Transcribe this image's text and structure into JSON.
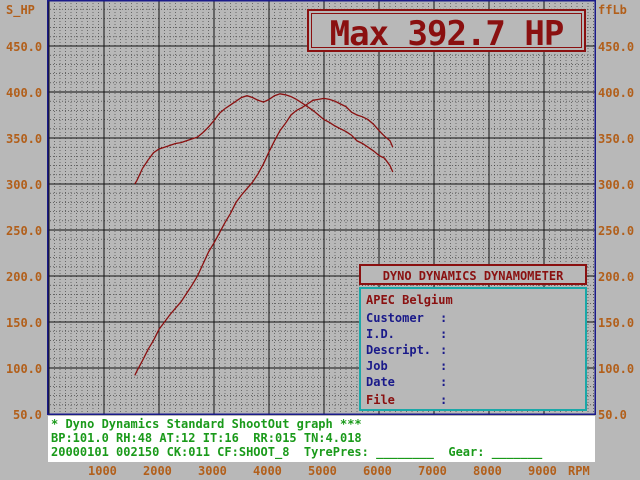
{
  "left_axis": {
    "unit": "S_HP",
    "ticks": [
      "450.0",
      "400.0",
      "350.0",
      "300.0",
      "250.0",
      "200.0",
      "150.0",
      "100.0",
      "50.0"
    ]
  },
  "right_axis": {
    "unit": "ffLb",
    "ticks": [
      "450.0",
      "400.0",
      "350.0",
      "300.0",
      "250.0",
      "200.0",
      "150.0",
      "100.0",
      "50.0"
    ]
  },
  "x_axis": {
    "unit": "RPM",
    "ticks": [
      "1000",
      "2000",
      "3000",
      "4000",
      "5000",
      "6000",
      "7000",
      "8000",
      "9000"
    ]
  },
  "max_readout": "Max 392.7 HP",
  "info_panel": {
    "title": "DYNO DYNAMICS DYNAMOMETER",
    "company": "APEC Belgium",
    "labels": [
      "Customer",
      "I.D.",
      "Descript.",
      "Job",
      "Date",
      "File"
    ],
    "colon": ":"
  },
  "footer": {
    "line1": "* Dyno Dynamics Standard ShootOut graph ***",
    "line2": "BP:101.0 RH:48 AT:12 IT:16  RR:015 TN:4.018",
    "line3": "20000101 002150 CK:011 CF:SHOOT_8  TyrePres: ________  Gear: _______"
  },
  "colors": {
    "background": "#b8b8b8",
    "grid": "#222222",
    "curve": "#8a1010",
    "axis_text": "#b25f1a",
    "info_label": "#1a1a8a",
    "footer_text": "#1a9a1a",
    "info_border": "#1aa8a8"
  },
  "chart_data": {
    "type": "line",
    "xlabel": "RPM",
    "ylabel": "S_HP",
    "y2label": "ffLb",
    "xlim": [
      1000,
      9000
    ],
    "ylim": [
      50,
      450
    ],
    "grid": true,
    "series": [
      {
        "x": [
          1560,
          1600,
          1700,
          1800,
          1900,
          2000,
          2100,
          2200,
          2300,
          2400,
          2500,
          2600,
          2700,
          2800,
          2900,
          3000,
          3100,
          3200,
          3300,
          3400,
          3500,
          3600,
          3700,
          3800,
          3900,
          4000,
          4100,
          4200,
          4300,
          4400,
          4500,
          4600,
          4700,
          4800,
          4900,
          5000,
          5100,
          5200,
          5300,
          5400,
          5500,
          5600,
          5700,
          5800,
          5900,
          6000,
          6100,
          6200,
          6250
        ],
        "values": [
          92,
          97,
          108,
          120,
          130,
          142,
          150,
          158,
          165,
          172,
          181,
          190,
          200,
          213,
          226,
          236,
          247,
          258,
          268,
          280,
          288,
          295,
          302,
          311,
          322,
          335,
          347,
          358,
          366,
          375,
          380,
          383,
          387,
          391,
          392,
          393,
          392,
          390,
          387,
          384,
          378,
          375,
          373,
          370,
          365,
          358,
          352,
          347,
          340
        ]
      },
      {
        "x": [
          1560,
          1600,
          1700,
          1800,
          1900,
          2000,
          2100,
          2200,
          2300,
          2400,
          2500,
          2600,
          2700,
          2800,
          2900,
          3000,
          3100,
          3200,
          3300,
          3400,
          3500,
          3600,
          3700,
          3800,
          3900,
          4000,
          4100,
          4200,
          4300,
          4400,
          4500,
          4600,
          4700,
          4800,
          4900,
          5000,
          5100,
          5200,
          5300,
          5400,
          5500,
          5600,
          5700,
          5800,
          5900,
          6000,
          6100,
          6200,
          6250
        ],
        "values": [
          300,
          304,
          317,
          326,
          334,
          338,
          340,
          342,
          344,
          345,
          347,
          349,
          351,
          356,
          362,
          369,
          377,
          382,
          386,
          390,
          394,
          396,
          394,
          391,
          389,
          392,
          396,
          398,
          397,
          395,
          392,
          388,
          384,
          380,
          375,
          370,
          367,
          363,
          360,
          357,
          353,
          347,
          344,
          340,
          336,
          331,
          328,
          320,
          313
        ]
      }
    ]
  }
}
